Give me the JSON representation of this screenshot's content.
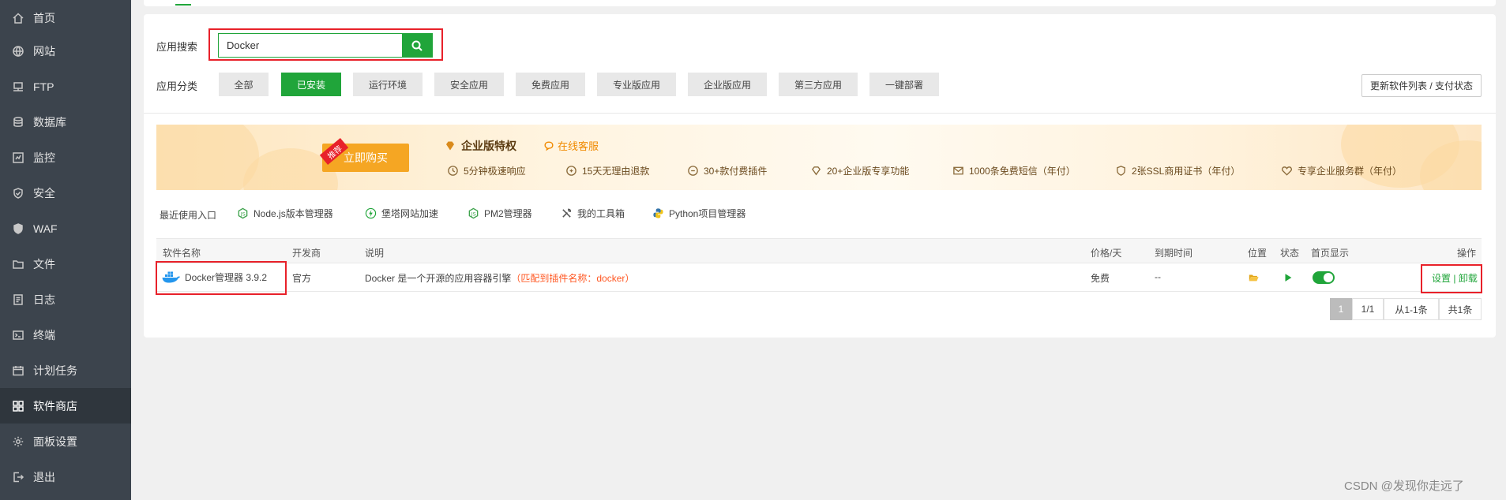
{
  "sidebar": {
    "items": [
      {
        "label": "首页",
        "icon": "home-icon"
      },
      {
        "label": "网站",
        "icon": "globe-icon"
      },
      {
        "label": "FTP",
        "icon": "ftp-icon"
      },
      {
        "label": "数据库",
        "icon": "database-icon"
      },
      {
        "label": "监控",
        "icon": "monitor-icon"
      },
      {
        "label": "安全",
        "icon": "shield-icon"
      },
      {
        "label": "WAF",
        "icon": "waf-shield-icon"
      },
      {
        "label": "文件",
        "icon": "folder-icon"
      },
      {
        "label": "日志",
        "icon": "log-icon"
      },
      {
        "label": "终端",
        "icon": "terminal-icon"
      },
      {
        "label": "计划任务",
        "icon": "calendar-icon"
      },
      {
        "label": "软件商店",
        "icon": "grid-icon",
        "active": true
      },
      {
        "label": "面板设置",
        "icon": "gear-icon"
      },
      {
        "label": "退出",
        "icon": "logout-icon"
      }
    ]
  },
  "search": {
    "label": "应用搜索",
    "value": "Docker",
    "button_icon": "search-icon"
  },
  "categories": {
    "label": "应用分类",
    "items": [
      "全部",
      "已安装",
      "运行环境",
      "安全应用",
      "免费应用",
      "专业版应用",
      "企业版应用",
      "第三方应用",
      "一键部署"
    ],
    "active": "已安装"
  },
  "refresh_button": "更新软件列表 / 支付状态",
  "banner": {
    "tag": "推荐",
    "buy_label": "立即购买",
    "title": "企业版特权",
    "service_link": "在线客服",
    "features": [
      "5分钟极速响应",
      "15天无理由退款",
      "30+款付费插件",
      "20+企业版专享功能",
      "1000条免费短信（年付）",
      "2张SSL商用证书（年付）",
      "专享企业服务群（年付）"
    ]
  },
  "recent": {
    "label": "最近使用入口",
    "items": [
      "Node.js版本管理器",
      "堡塔网站加速",
      "PM2管理器",
      "我的工具箱",
      "Python项目管理器"
    ]
  },
  "table": {
    "headers": {
      "name": "软件名称",
      "developer": "开发商",
      "description": "说明",
      "price": "价格/天",
      "expire": "到期时间",
      "location": "位置",
      "status": "状态",
      "home_display": "首页显示",
      "actions": "操作"
    },
    "rows": [
      {
        "name": "Docker管理器 3.9.2",
        "developer": "官方",
        "description": "Docker 是一个开源的应用容器引擎",
        "match_note": "（匹配到插件名称：docker）",
        "price": "免费",
        "expire": "--",
        "home_display": true,
        "action_settings": "设置",
        "action_separator": "|",
        "action_uninstall": "卸载"
      }
    ]
  },
  "pagination": {
    "current": "1",
    "pages": "1/1",
    "range": "从1-1条",
    "total": "共1条"
  },
  "watermark": "CSDN @发现你走远了",
  "colors": {
    "accent": "#20a53a",
    "sidebar_bg": "#3c444d",
    "highlight_red": "#e8212a",
    "match_orange": "#ff5722",
    "buy_orange": "#f5a623"
  }
}
